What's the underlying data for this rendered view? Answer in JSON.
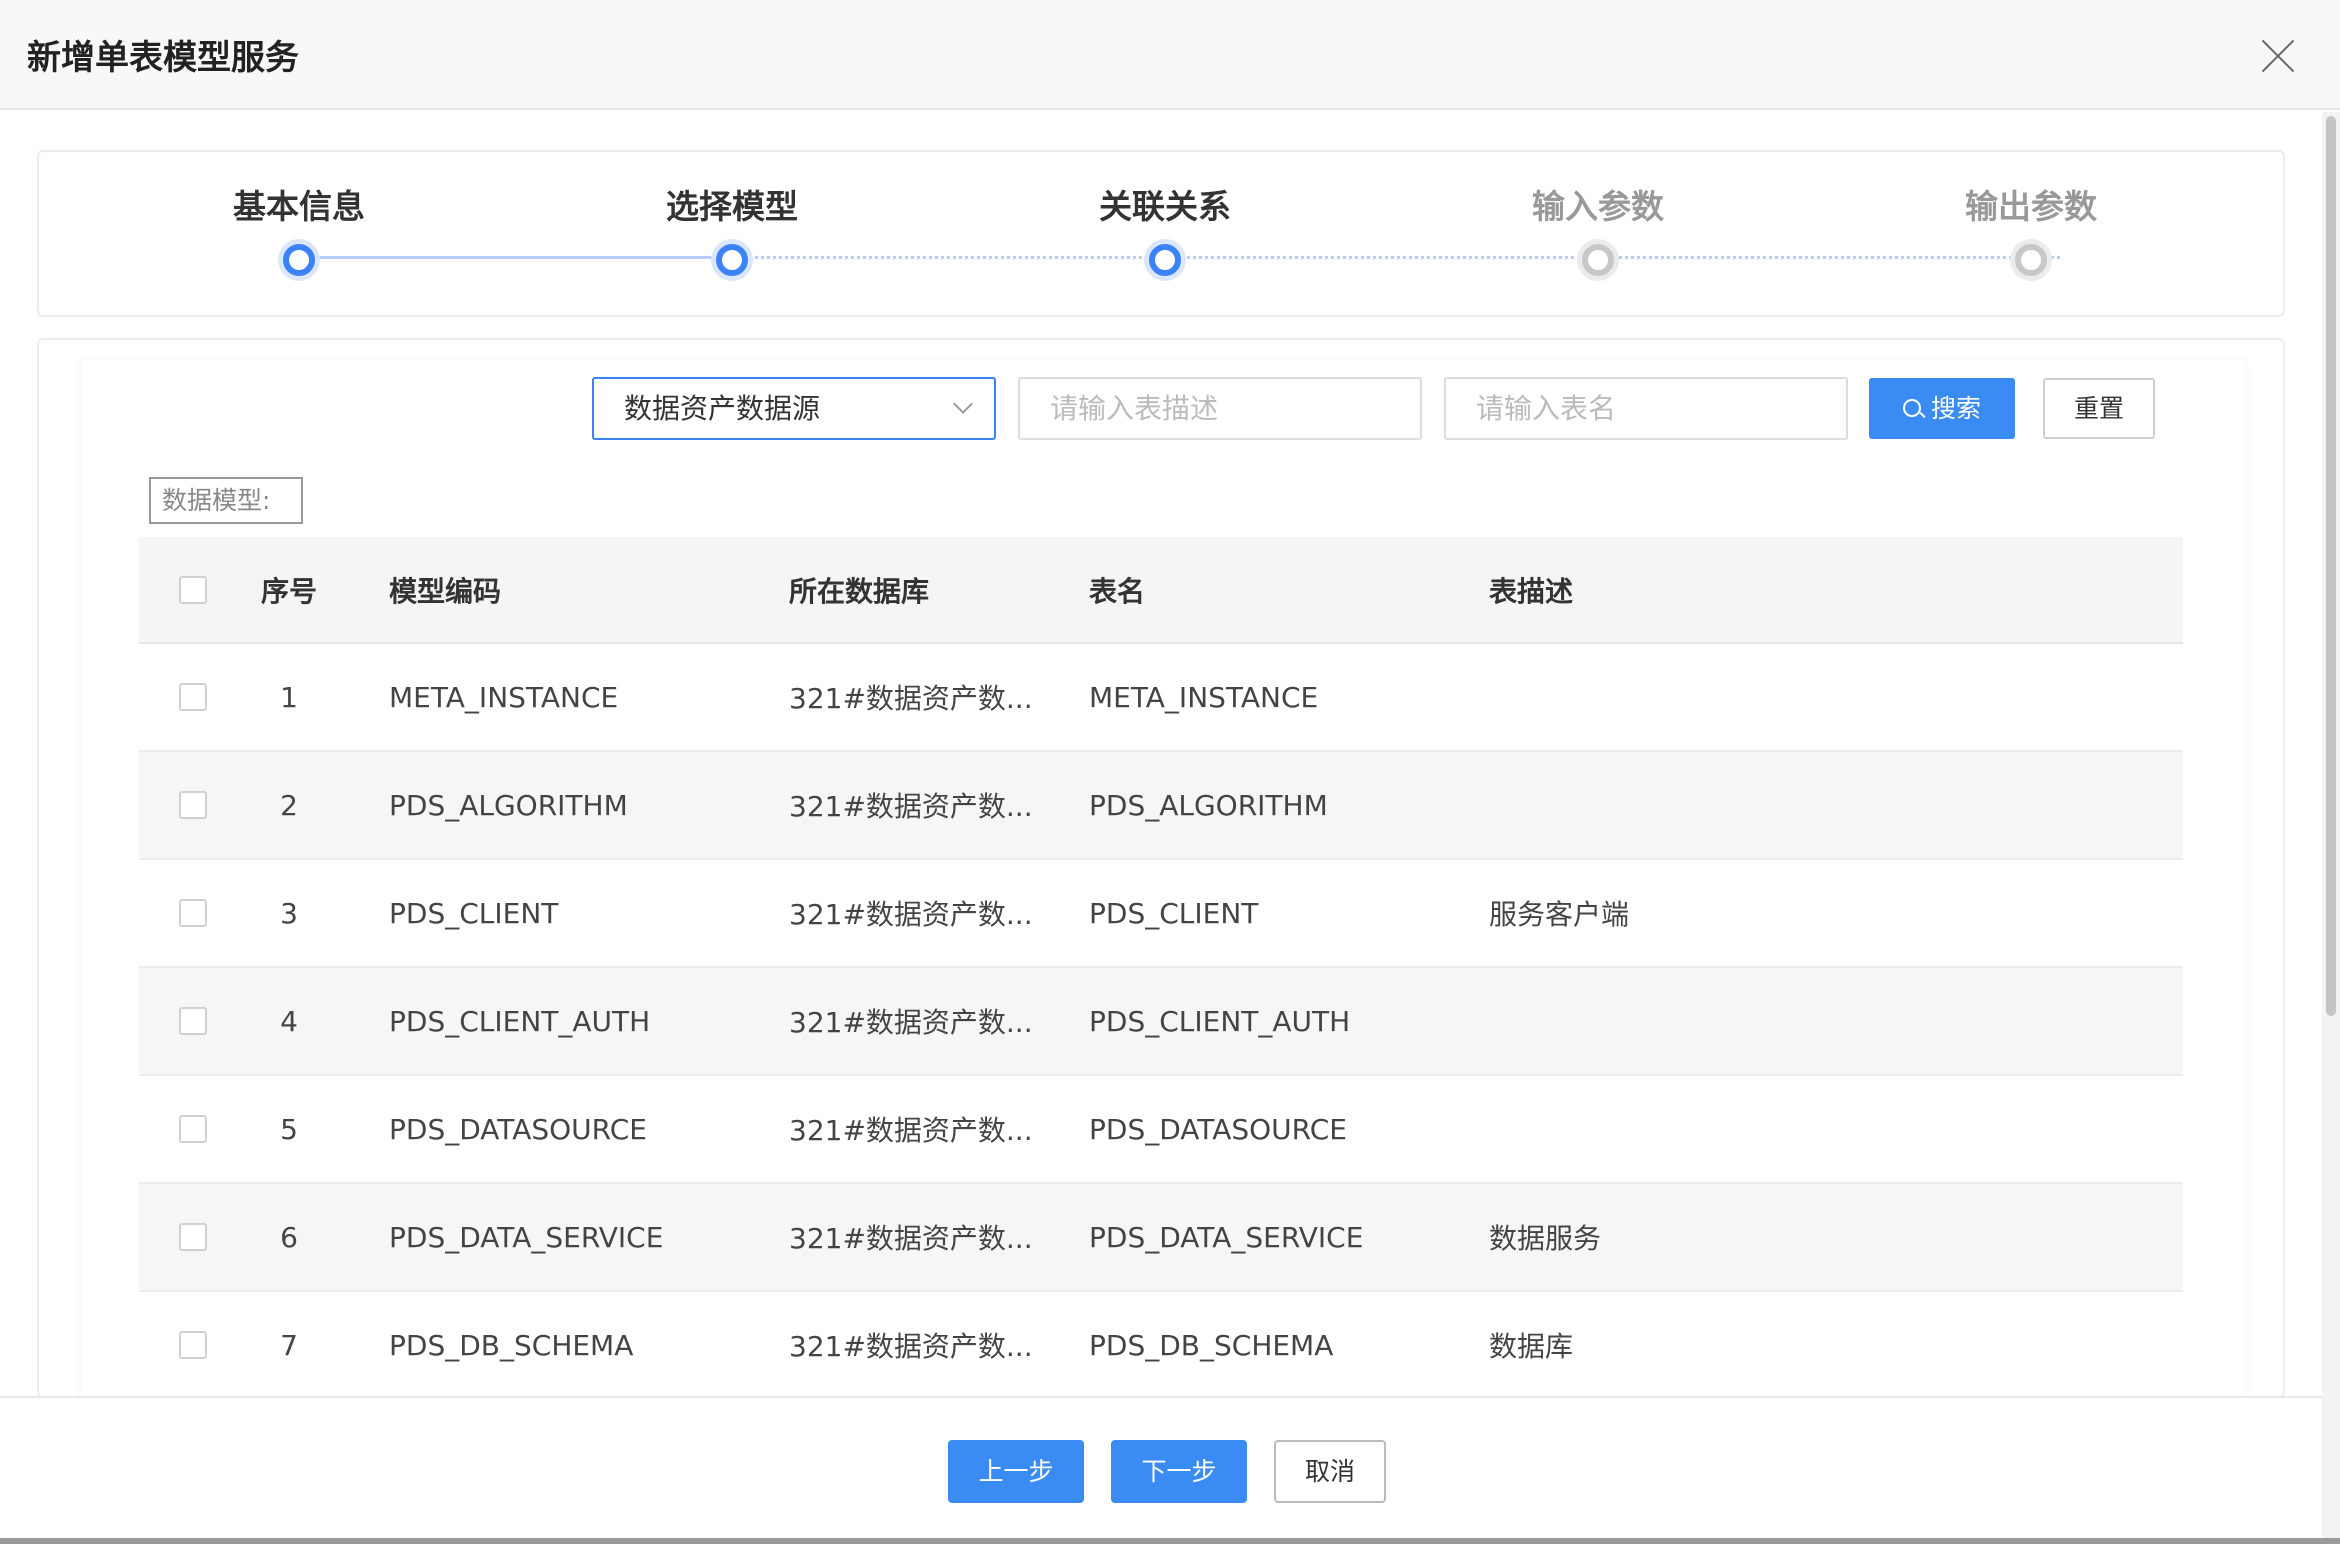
{
  "dialog": {
    "title": "新增单表模型服务"
  },
  "steps": [
    {
      "label": "基本信息",
      "status": "done"
    },
    {
      "label": "选择模型",
      "status": "current"
    },
    {
      "label": "关联关系",
      "status": "todo"
    },
    {
      "label": "输入参数",
      "status": "todo"
    },
    {
      "label": "输出参数",
      "status": "todo"
    }
  ],
  "filters": {
    "datasource_selected": "数据资产数据源",
    "desc_placeholder": "请输入表描述",
    "name_placeholder": "请输入表名",
    "search_label": "搜索",
    "reset_label": "重置"
  },
  "model_tag": "数据模型:",
  "table": {
    "columns": [
      "序号",
      "模型编码",
      "所在数据库",
      "表名",
      "表描述"
    ],
    "rows": [
      {
        "index": "1",
        "code": "META_INSTANCE",
        "database": "321#数据资产数...",
        "table": "META_INSTANCE",
        "desc": ""
      },
      {
        "index": "2",
        "code": "PDS_ALGORITHM",
        "database": "321#数据资产数...",
        "table": "PDS_ALGORITHM",
        "desc": ""
      },
      {
        "index": "3",
        "code": "PDS_CLIENT",
        "database": "321#数据资产数...",
        "table": "PDS_CLIENT",
        "desc": "服务客户端"
      },
      {
        "index": "4",
        "code": "PDS_CLIENT_AUTH",
        "database": "321#数据资产数...",
        "table": "PDS_CLIENT_AUTH",
        "desc": ""
      },
      {
        "index": "5",
        "code": "PDS_DATASOURCE",
        "database": "321#数据资产数...",
        "table": "PDS_DATASOURCE",
        "desc": ""
      },
      {
        "index": "6",
        "code": "PDS_DATA_SERVICE",
        "database": "321#数据资产数...",
        "table": "PDS_DATA_SERVICE",
        "desc": "数据服务"
      },
      {
        "index": "7",
        "code": "PDS_DB_SCHEMA",
        "database": "321#数据资产数...",
        "table": "PDS_DB_SCHEMA",
        "desc": "数据库"
      }
    ]
  },
  "footer": {
    "prev_label": "上一步",
    "next_label": "下一步",
    "cancel_label": "取消"
  },
  "colors": {
    "primary": "#3b8bf5",
    "step_active": "#3b82f6",
    "step_inactive": "#c8c8c8"
  }
}
